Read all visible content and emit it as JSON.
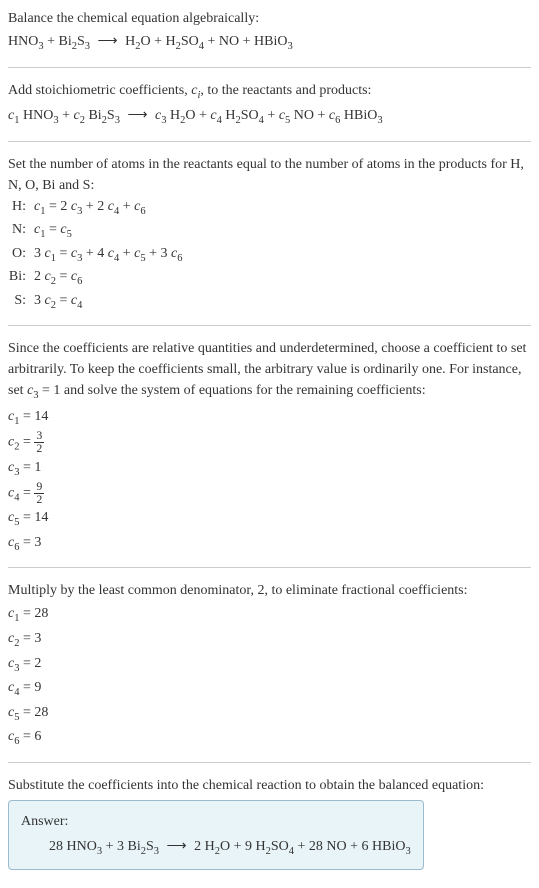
{
  "intro": {
    "line1": "Balance the chemical equation algebraically:",
    "eq": "HNO₃ + Bi₂S₃ ⟶ H₂O + H₂SO₄ + NO + HBiO₃"
  },
  "step1": {
    "text": "Add stoichiometric coefficients, cᵢ, to the reactants and products:",
    "eq": "c₁ HNO₃ + c₂ Bi₂S₃ ⟶ c₃ H₂O + c₄ H₂SO₄ + c₅ NO + c₆ HBiO₃"
  },
  "step2": {
    "text": "Set the number of atoms in the reactants equal to the number of atoms in the products for H, N, O, Bi and S:",
    "rows": [
      {
        "label": "H:",
        "eq": "c₁ = 2 c₃ + 2 c₄ + c₆"
      },
      {
        "label": "N:",
        "eq": "c₁ = c₅"
      },
      {
        "label": "O:",
        "eq": "3 c₁ = c₃ + 4 c₄ + c₅ + 3 c₆"
      },
      {
        "label": "Bi:",
        "eq": "2 c₂ = c₆"
      },
      {
        "label": "S:",
        "eq": "3 c₂ = c₄"
      }
    ]
  },
  "step3": {
    "text": "Since the coefficients are relative quantities and underdetermined, choose a coefficient to set arbitrarily. To keep the coefficients small, the arbitrary value is ordinarily one. For instance, set c₃ = 1 and solve the system of equations for the remaining coefficients:",
    "coefs": [
      "c₁ = 14",
      "c₂ = 3/2",
      "c₃ = 1",
      "c₄ = 9/2",
      "c₅ = 14",
      "c₆ = 3"
    ]
  },
  "step4": {
    "text": "Multiply by the least common denominator, 2, to eliminate fractional coefficients:",
    "coefs": [
      "c₁ = 28",
      "c₂ = 3",
      "c₃ = 2",
      "c₄ = 9",
      "c₅ = 28",
      "c₆ = 6"
    ]
  },
  "final": {
    "text": "Substitute the coefficients into the chemical reaction to obtain the balanced equation:",
    "answer_label": "Answer:",
    "answer_eq": "28 HNO₃ + 3 Bi₂S₃ ⟶ 2 H₂O + 9 H₂SO₄ + 28 NO + 6 HBiO₃"
  }
}
